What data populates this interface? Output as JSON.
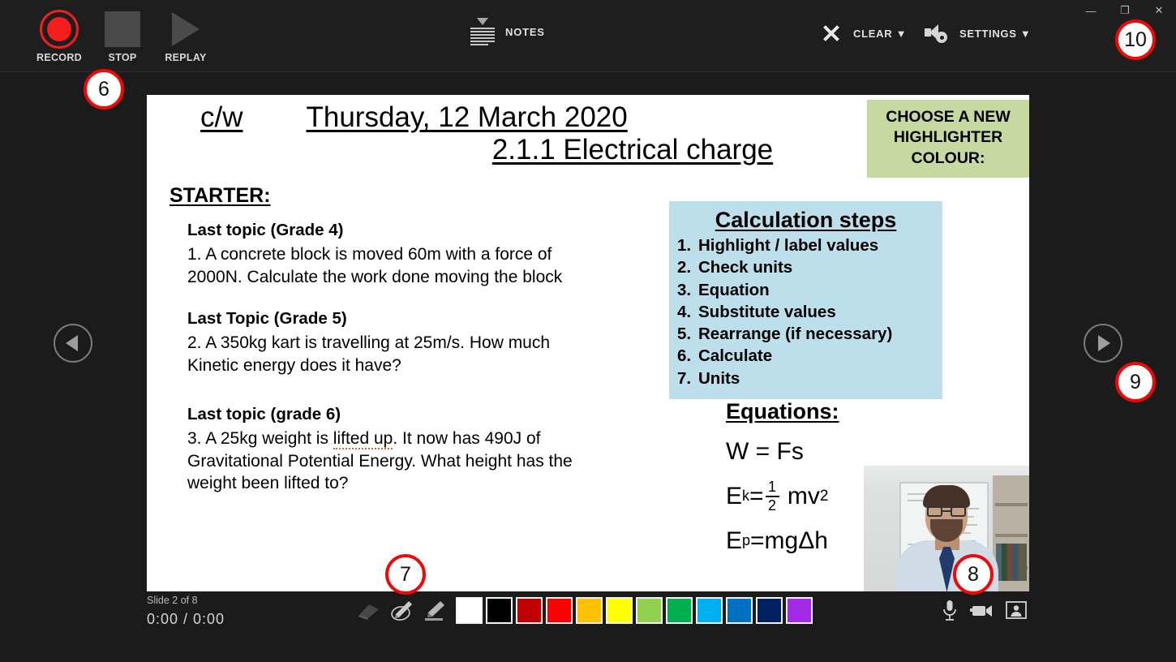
{
  "window": {
    "minimize_label": "—",
    "restore_label": "❐",
    "close_label": "✕"
  },
  "toolbar": {
    "record_label": "RECORD",
    "stop_label": "STOP",
    "replay_label": "REPLAY",
    "notes_label": "NOTES",
    "clear_label": "CLEAR ▼",
    "settings_label": "SETTINGS ▼"
  },
  "slide": {
    "cw": "c/w",
    "date": "Thursday, 12 March 2020",
    "subtitle": "2.1.1 Electrical charge",
    "highlighter_box": {
      "line1": "CHOOSE A NEW",
      "line2": "HIGHLIGHTER",
      "line3": "COLOUR:",
      "bg_color": "#c6d9a1"
    },
    "starter_heading": "STARTER:",
    "questions": [
      {
        "head": "Last topic (Grade 4)",
        "body": "1. A concrete block is moved 60m with a force of 2000N. Calculate the work done moving the block"
      },
      {
        "head": "Last Topic (Grade 5)",
        "body": "2. A 350kg kart is travelling at 25m/s. How much Kinetic energy does it have?"
      },
      {
        "head": "Last topic (grade 6)",
        "body_part1": "3. A 25kg weight is ",
        "body_spell": "lifted up",
        "body_part2": ". It now has 490J of Gravitational Potential Energy. What height has the weight been lifted to?"
      }
    ],
    "calc_box": {
      "title": "Calculation steps",
      "bg_color": "#bddfeb",
      "steps": [
        {
          "num": "1.",
          "text": "Highlight  / label values"
        },
        {
          "num": "2.",
          "text": "Check units"
        },
        {
          "num": "3.",
          "text": "Equation"
        },
        {
          "num": "4.",
          "text": "Substitute values"
        },
        {
          "num": "5.",
          "text": "Rearrange (if necessary)"
        },
        {
          "num": "6.",
          "text": "Calculate"
        },
        {
          "num": "7.",
          "text": "Units"
        }
      ]
    },
    "equations": {
      "title": "Equations:",
      "eq1": "W = Fs",
      "eq2_base": "E",
      "eq2_sub": "k",
      "eq2_eq": "=",
      "eq2_num": "1",
      "eq2_den": "2",
      "eq2_tail": "mv",
      "eq2_sup": "2",
      "eq3_base": "E",
      "eq3_sub": "p",
      "eq3_tail": "=mgΔh"
    }
  },
  "statusbar": {
    "slide_counter": "Slide 2 of 8",
    "time": "0:00 / 0:00"
  },
  "pen_tools": [
    {
      "name": "eraser",
      "title": "Eraser"
    },
    {
      "name": "pen",
      "title": "Pen"
    },
    {
      "name": "highlighter",
      "title": "Highlighter"
    }
  ],
  "swatches": [
    {
      "name": "white",
      "color": "#ffffff"
    },
    {
      "name": "black",
      "color": "#000000"
    },
    {
      "name": "dark-red",
      "color": "#c00000"
    },
    {
      "name": "red",
      "color": "#fe0000"
    },
    {
      "name": "amber",
      "color": "#ffc000"
    },
    {
      "name": "yellow",
      "color": "#ffff00"
    },
    {
      "name": "light-green",
      "color": "#92d050"
    },
    {
      "name": "green",
      "color": "#00b050"
    },
    {
      "name": "cyan",
      "color": "#00b0f0"
    },
    {
      "name": "blue",
      "color": "#0070c0"
    },
    {
      "name": "navy",
      "color": "#002060"
    },
    {
      "name": "purple",
      "color": "#a329e8"
    }
  ],
  "devices": [
    {
      "name": "microphone"
    },
    {
      "name": "video-camera"
    },
    {
      "name": "webcam-overlay"
    }
  ],
  "callouts": [
    {
      "id": "6",
      "num": "6"
    },
    {
      "id": "7",
      "num": "7"
    },
    {
      "id": "8",
      "num": "8"
    },
    {
      "id": "9",
      "num": "9"
    },
    {
      "id": "10",
      "num": "10"
    }
  ]
}
